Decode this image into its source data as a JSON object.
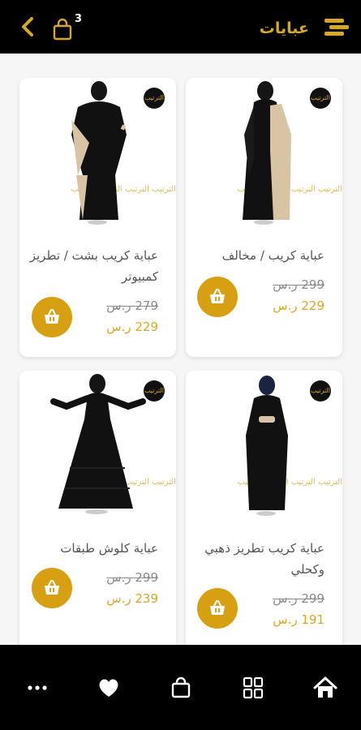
{
  "header": {
    "title": "عبايات",
    "cart_count": "3",
    "back_icon": "chevron-left-icon",
    "cart_icon": "shopping-bag-icon",
    "menu_icon": "menu-icon"
  },
  "products": [
    {
      "name": "عباية كريب / مخالف",
      "old_price": "299 ر.س",
      "new_price": "229 ر.س",
      "brand_mark": "الترتيب",
      "watermark_text": "الترتيب الترتيب الترتيب الترتيب"
    },
    {
      "name": "عباية كريب بشت / تطريز كمبيوتر",
      "old_price": "279 ر.س",
      "new_price": "229 ر.س",
      "brand_mark": "الترتيب",
      "watermark_text": "الترتيب الترتيب الترتيب الترتيب"
    },
    {
      "name": "عباية كريب تطريز ذهبي وكحلي",
      "old_price": "299 ر.س",
      "new_price": "191 ر.س",
      "brand_mark": "الترتيب",
      "watermark_text": "الترتيب الترتيب الترتيب الترتيب"
    },
    {
      "name": "عباية كلوش طبقات",
      "old_price": "299 ر.س",
      "new_price": "239 ر.س",
      "brand_mark": "الترتيب",
      "watermark_text": "الترتيب الترتيب الترتيب الترتيب"
    }
  ],
  "bottom_nav": {
    "items": [
      "home-icon",
      "grid-icon",
      "shopping-bag-icon",
      "heart-icon",
      "more-icon"
    ]
  },
  "colors": {
    "accent": "#d7a72a",
    "button": "#d79f12",
    "bar": "#000000"
  }
}
